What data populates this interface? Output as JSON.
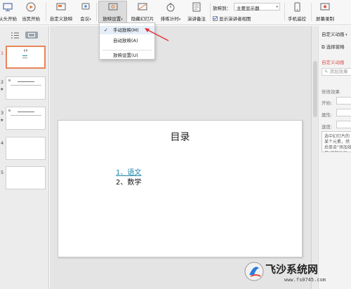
{
  "ribbon": {
    "buttons": [
      {
        "label": "从头开始",
        "icon": "start-from-beginning-icon"
      },
      {
        "label": "当页开始",
        "icon": "start-current-icon"
      },
      {
        "label": "自定义放映",
        "icon": "custom-show-icon"
      },
      {
        "label": "会议",
        "icon": "meeting-icon"
      },
      {
        "label": "放映设置",
        "icon": "slideshow-settings-icon"
      },
      {
        "label": "隐藏幻灯片",
        "icon": "hide-slide-icon"
      },
      {
        "label": "排练计时",
        "icon": "rehearse-timing-icon"
      },
      {
        "label": "演讲备注",
        "icon": "speaker-notes-icon"
      },
      {
        "label": "手机遥控",
        "icon": "phone-remote-icon"
      },
      {
        "label": "屏幕录制",
        "icon": "screen-record-icon"
      }
    ],
    "show_on_label": "放映到：",
    "show_on_value": "主要显示器",
    "presenter_view_label": "显示演讲者视图",
    "presenter_view_checked": true
  },
  "dropdown": {
    "items": [
      {
        "label": "手动放映(M)",
        "checked": true
      },
      {
        "label": "自动放映(A)",
        "checked": false
      },
      {
        "label": "放映设置(U)",
        "checked": false
      }
    ]
  },
  "slides": [
    {
      "number": "1",
      "selected": true,
      "title": "目录"
    },
    {
      "number": "2",
      "selected": false
    },
    {
      "number": "3",
      "selected": false
    },
    {
      "number": "4",
      "selected": false
    },
    {
      "number": "5",
      "selected": false
    }
  ],
  "slide": {
    "title": "目录",
    "items": [
      "1、语文",
      "2、数学"
    ]
  },
  "right_panel": {
    "header": "自定义动画",
    "select_pane": "选择窗格",
    "section_title": "自定义动画",
    "add_effect": "添加效果",
    "modify_effect": "修改效果",
    "start_label": "开始:",
    "property_label": "属性:",
    "speed_label": "速度:",
    "hint": "选中幻灯片的某个元素，然后单击\"添加效果\"添加动画。"
  },
  "watermark": {
    "brand": "飞沙系统网",
    "url": "www.fs0745.com"
  },
  "colors": {
    "accent_red": "#d9534f",
    "link_teal": "#1c87a6",
    "selected_thumb_border": "#e8855a"
  }
}
